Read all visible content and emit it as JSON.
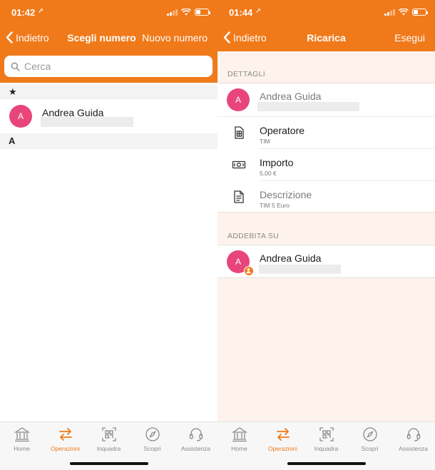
{
  "colors": {
    "accent": "#f07a1a",
    "avatar": "#e8457a",
    "inactive_tab": "#8a8a8a"
  },
  "left": {
    "status_time": "01:42",
    "nav": {
      "back_label": "Indietro",
      "title": "Scegli numero",
      "action": "Nuovo numero"
    },
    "search": {
      "placeholder": "Cerca",
      "icon": "search-icon"
    },
    "favorites_header": "★",
    "favorite_contact": {
      "initial": "A",
      "name": "Andrea Guida"
    },
    "section_a_header": "A"
  },
  "right": {
    "status_time": "01:44",
    "nav": {
      "back_label": "Indietro",
      "title": "Ricarica",
      "action": "Esegui"
    },
    "details_label": "DETTAGLI",
    "recipient": {
      "initial": "A",
      "name": "Andrea Guida"
    },
    "operator": {
      "title": "Operatore",
      "value": "TIM",
      "icon": "sim-card-icon"
    },
    "amount": {
      "title": "Importo",
      "value": "5,00 €",
      "icon": "banknote-icon"
    },
    "description": {
      "title": "Descrizione",
      "value": "TIM 5 Euro",
      "icon": "document-icon"
    },
    "charge_label": "ADDEBITA SU",
    "payer": {
      "initial": "A",
      "name": "Andrea Guida",
      "badge_icon": "person-icon"
    }
  },
  "tabbar": {
    "active": "Operazioni",
    "items": [
      {
        "label": "Home",
        "icon": "bank-icon"
      },
      {
        "label": "Operazioni",
        "icon": "transfer-arrows-icon"
      },
      {
        "label": "Inquadra",
        "icon": "qr-scan-icon"
      },
      {
        "label": "Scopri",
        "icon": "compass-icon"
      },
      {
        "label": "Assistenza",
        "icon": "headset-icon"
      }
    ]
  }
}
